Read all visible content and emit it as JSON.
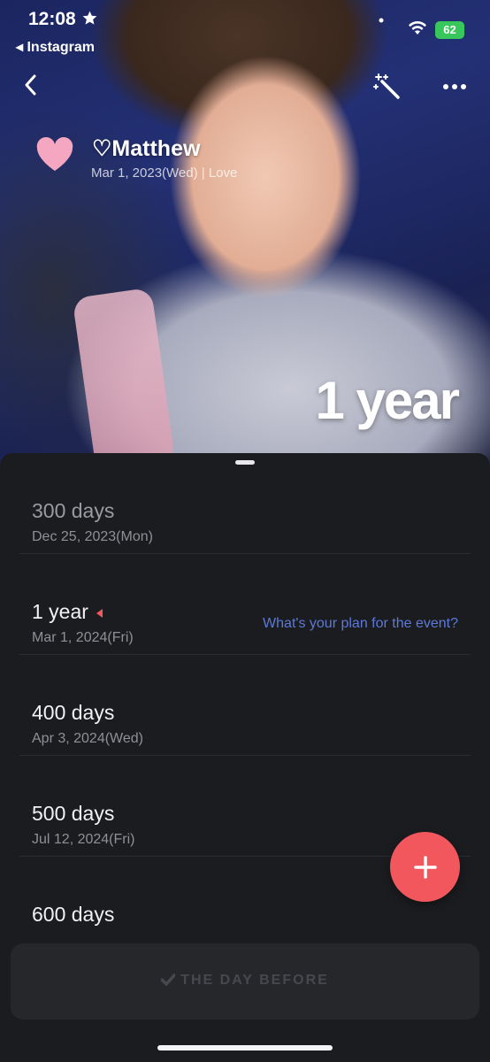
{
  "status_bar": {
    "time": "12:08",
    "back_app": "◂ Instagram",
    "battery": "62"
  },
  "hero": {
    "name": "♡Matthew",
    "meta": "Mar 1, 2023(Wed)  |  Love",
    "big_count": "1 year"
  },
  "events": [
    {
      "title": "300 days",
      "date": "Dec 25, 2023(Mon)"
    },
    {
      "title": "1 year",
      "date": "Mar 1, 2024(Fri)",
      "plan": "What's your plan for the event?"
    },
    {
      "title": "400 days",
      "date": "Apr 3, 2024(Wed)"
    },
    {
      "title": "500 days",
      "date": "Jul 12, 2024(Fri)"
    },
    {
      "title": "600 days",
      "date": ""
    }
  ],
  "bottom_bar": {
    "label": "THE DAY BEFORE"
  },
  "colors": {
    "accent": "#f2575e",
    "link": "#5d79d9",
    "sheet": "#1b1c1f",
    "heart": "#f5a7c1"
  },
  "icons": [
    "star-icon",
    "signal-icon",
    "wifi-icon",
    "battery-icon",
    "back-icon",
    "magic-wand-icon",
    "more-icon",
    "heart-icon",
    "flag-icon",
    "plus-icon",
    "check-icon"
  ]
}
